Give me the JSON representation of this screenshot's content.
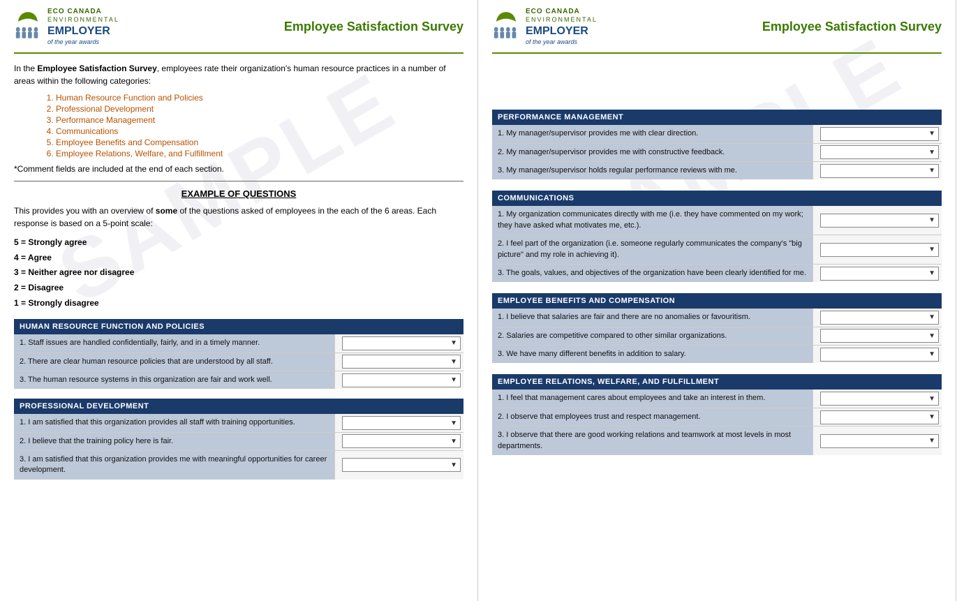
{
  "left": {
    "logo": {
      "eco": "ECO CANADA",
      "environmental": "ENVIRONMENTAL",
      "employer": "EMPLOYER",
      "year": "of the year awards"
    },
    "survey_title": "Employee Satisfaction Survey",
    "intro": {
      "text_before": "In the ",
      "bold": "Employee Satisfaction Survey",
      "text_after": ", employees rate their organization's human resource practices in a number of areas within the following categories:"
    },
    "categories": [
      "Human Resource Function and Policies",
      "Professional Development",
      "Performance Management",
      "Communications",
      "Employee Benefits and Compensation",
      "Employee Relations, Welfare, and Fulfillment"
    ],
    "comment_note": "*Comment fields are included at the end of each section.",
    "example_heading": "EXAMPLE OF QUESTIONS",
    "example_text_before": "This provides you with an overview of ",
    "example_bold": "some",
    "example_text_after": " of the questions asked of employees in the each of the 6 areas. Each response is based on a 5-point scale:",
    "scale": [
      "5 = Strongly agree",
      "4 = Agree",
      "3 = Neither agree nor disagree",
      "2 = Disagree",
      "1 = Strongly disagree"
    ],
    "sections": [
      {
        "id": "hr",
        "header": "HUMAN RESOURCE FUNCTION AND POLICIES",
        "questions": [
          "1. Staff issues are handled confidentially, fairly, and in a timely manner.",
          "2. There are clear human resource policies that are understood by all staff.",
          "3. The human resource systems in this organization are fair and work well."
        ]
      },
      {
        "id": "pd",
        "header": "PROFESSIONAL DEVELOPMENT",
        "questions": [
          "1. I am satisfied that this organization provides all staff with training opportunities.",
          "2. I believe that the training policy here is fair.",
          "3. I am satisfied that this organization provides me with meaningful opportunities for career development."
        ]
      }
    ],
    "watermark": "SAMPLE"
  },
  "right": {
    "logo": {
      "eco": "ECO CANADA",
      "environmental": "ENVIRONMENTAL",
      "employer": "EMPLOYER",
      "year": "of the year awards"
    },
    "survey_title": "Employee Satisfaction Survey",
    "sections": [
      {
        "id": "pm",
        "header": "PERFORMANCE MANAGEMENT",
        "questions": [
          "1. My manager/supervisor provides me with clear direction.",
          "2. My manager/supervisor provides me with constructive feedback.",
          "3. My manager/supervisor holds regular performance reviews with me."
        ]
      },
      {
        "id": "comm",
        "header": "COMMUNICATIONS",
        "questions": [
          "1. My organization communicates directly with me (i.e. they have commented on my work; they have asked what motivates me, etc.).",
          "2. I feel part of the organization (i.e. someone regularly communicates the company's \"big picture\" and my role in achieving it).",
          "3. The goals, values, and objectives of the organization have been clearly identified for me."
        ]
      },
      {
        "id": "ebc",
        "header": "EMPLOYEE BENEFITS AND COMPENSATION",
        "questions": [
          "1. I believe that salaries are fair and there are no anomalies or favouritism.",
          "2. Salaries are competitive compared to other similar organizations.",
          "3. We have many different benefits in addition to salary."
        ]
      },
      {
        "id": "erw",
        "header": "EMPLOYEE RELATIONS, WELFARE, AND FULFILLMENT",
        "questions": [
          "1. I feel that management cares about employees and take an interest in them.",
          "2. I observe that employees trust and respect management.",
          "3. I observe that there are good working relations and teamwork at most levels in most departments."
        ]
      }
    ],
    "watermark": "SAMPLE"
  }
}
